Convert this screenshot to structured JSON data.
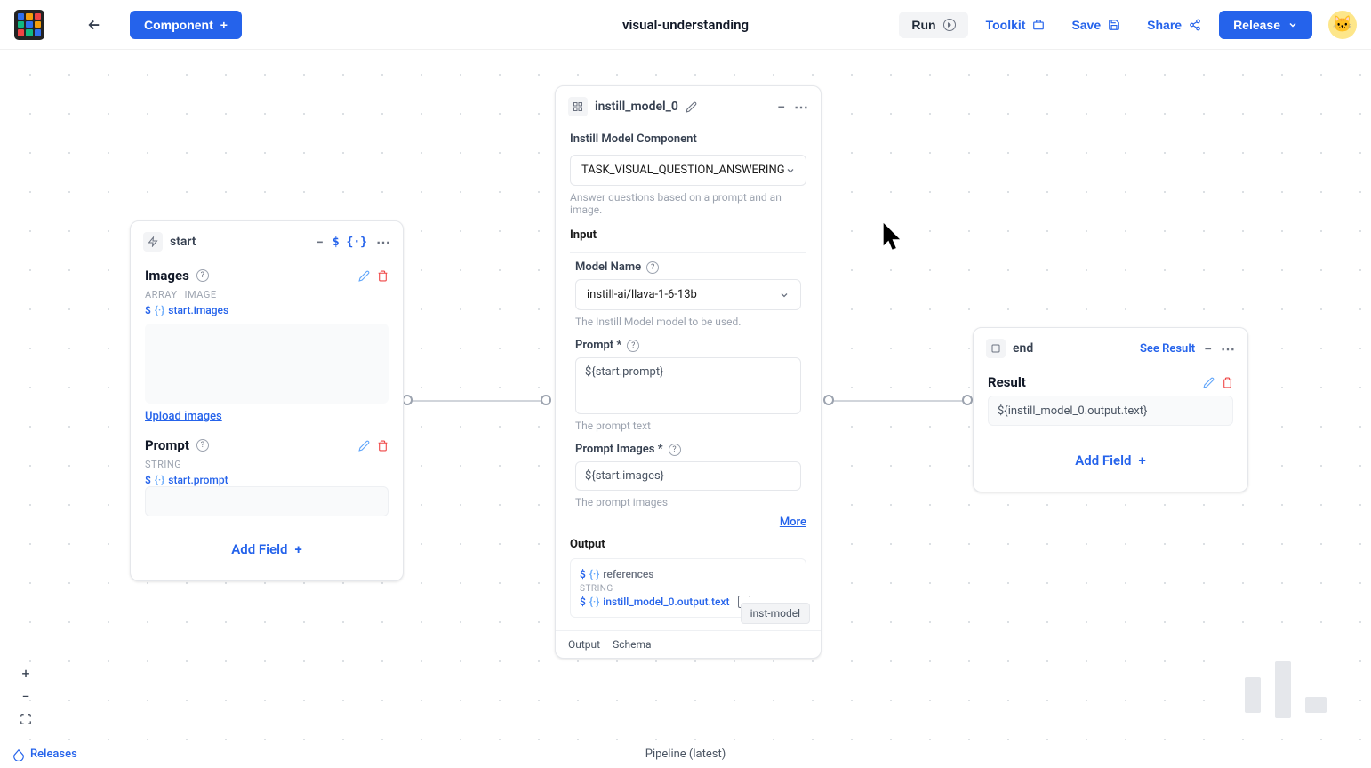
{
  "header": {
    "component_button": "Component",
    "title": "visual-understanding",
    "run": "Run",
    "toolkit": "Toolkit",
    "save": "Save",
    "share": "Share",
    "release": "Release"
  },
  "start_node": {
    "name": "start",
    "images_label": "Images",
    "images_type_1": "ARRAY",
    "images_type_2": "IMAGE",
    "images_ref": "start.images",
    "upload": "Upload images",
    "prompt_label": "Prompt",
    "prompt_type": "STRING",
    "prompt_ref": "start.prompt",
    "add_field": "Add Field"
  },
  "model_node": {
    "name": "instill_model_0",
    "title": "Instill Model Component",
    "task": "TASK_VISUAL_QUESTION_ANSWERING",
    "task_hint": "Answer questions based on a prompt and an image.",
    "input_label": "Input",
    "model_name_label": "Model Name",
    "model_name_value": "instill-ai/llava-1-6-13b",
    "model_name_hint": "The Instill Model model to be used.",
    "prompt_label": "Prompt *",
    "prompt_value": "${start.prompt}",
    "prompt_hint": "The prompt text",
    "prompt_images_label": "Prompt Images *",
    "prompt_images_value": "${start.images}",
    "prompt_images_hint": "The prompt images",
    "more": "More",
    "output_label": "Output",
    "output_refs_label": "references",
    "output_type": "STRING",
    "output_ref": "instill_model_0.output.text",
    "footer_tag": "inst-model",
    "tab_output": "Output",
    "tab_schema": "Schema"
  },
  "end_node": {
    "name": "end",
    "see_result": "See Result",
    "result_label": "Result",
    "result_value": "${instill_model_0.output.text}",
    "add_field": "Add Field"
  },
  "footer": {
    "releases": "Releases",
    "pipeline": "Pipeline (latest)"
  }
}
